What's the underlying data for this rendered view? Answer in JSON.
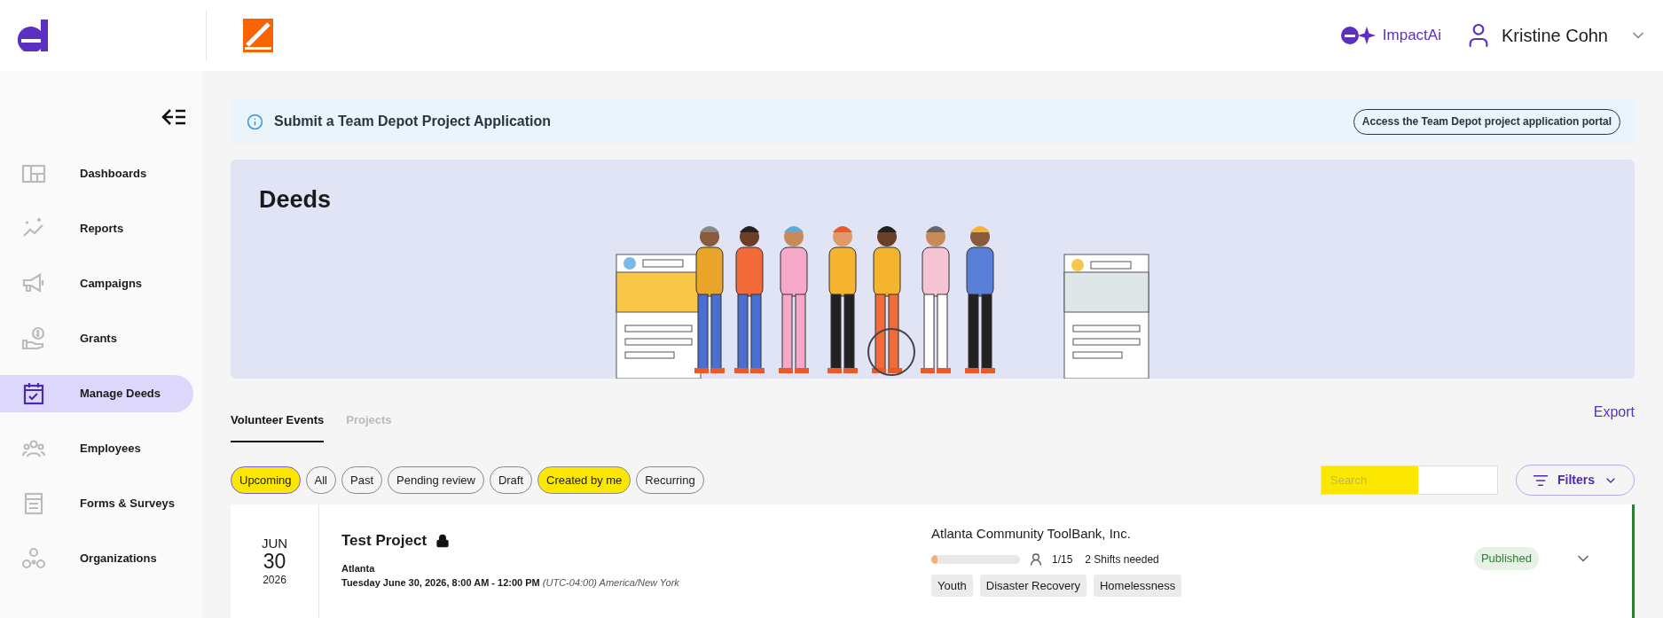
{
  "header": {
    "ai_label": "ImpactAi",
    "user_name": "Kristine Cohn"
  },
  "sidebar": {
    "items": [
      {
        "label": "Dashboards",
        "selected": false
      },
      {
        "label": "Reports",
        "selected": false
      },
      {
        "label": "Campaigns",
        "selected": false
      },
      {
        "label": "Grants",
        "selected": false
      },
      {
        "label": "Manage Deeds",
        "selected": true
      },
      {
        "label": "Employees",
        "selected": false
      },
      {
        "label": "Forms & Surveys",
        "selected": false
      },
      {
        "label": "Organizations",
        "selected": false
      }
    ]
  },
  "info_banner": {
    "text": "Submit a Team Depot Project Application",
    "button": "Access the Team Depot project application portal"
  },
  "hero": {
    "title": "Deeds"
  },
  "tabs": [
    {
      "label": "Volunteer Events",
      "selected": true
    },
    {
      "label": "Projects",
      "selected": false
    }
  ],
  "export_link": "Export",
  "chips": [
    {
      "label": "Upcoming",
      "selected": true,
      "highlighted": true
    },
    {
      "label": "All",
      "selected": false,
      "highlighted": false
    },
    {
      "label": "Past",
      "selected": false,
      "highlighted": false
    },
    {
      "label": "Pending review",
      "selected": false,
      "highlighted": false
    },
    {
      "label": "Draft",
      "selected": false,
      "highlighted": false
    },
    {
      "label": "Created by me",
      "selected": false,
      "highlighted": true
    },
    {
      "label": "Recurring",
      "selected": false,
      "highlighted": false
    }
  ],
  "search": {
    "placeholder": "Search",
    "highlighted": true
  },
  "filters_button": "Filters",
  "events": [
    {
      "month": "JUN",
      "day": "30",
      "year": "2026",
      "title": "Test Project",
      "locked": true,
      "location": "Atlanta",
      "datetime": "Tuesday June 30, 2026, 8:00 AM - 12:00 PM",
      "timezone": "(UTC-04:00) America/New York",
      "organization": "Atlanta Community ToolBank, Inc.",
      "level": 0.07,
      "volunteers": "1/15",
      "shifts": "2 Shifts needed",
      "tags": [
        "Youth",
        "Disaster Recovery",
        "Homelessness"
      ],
      "status": "Published",
      "color": "#2e7d32"
    }
  ]
}
